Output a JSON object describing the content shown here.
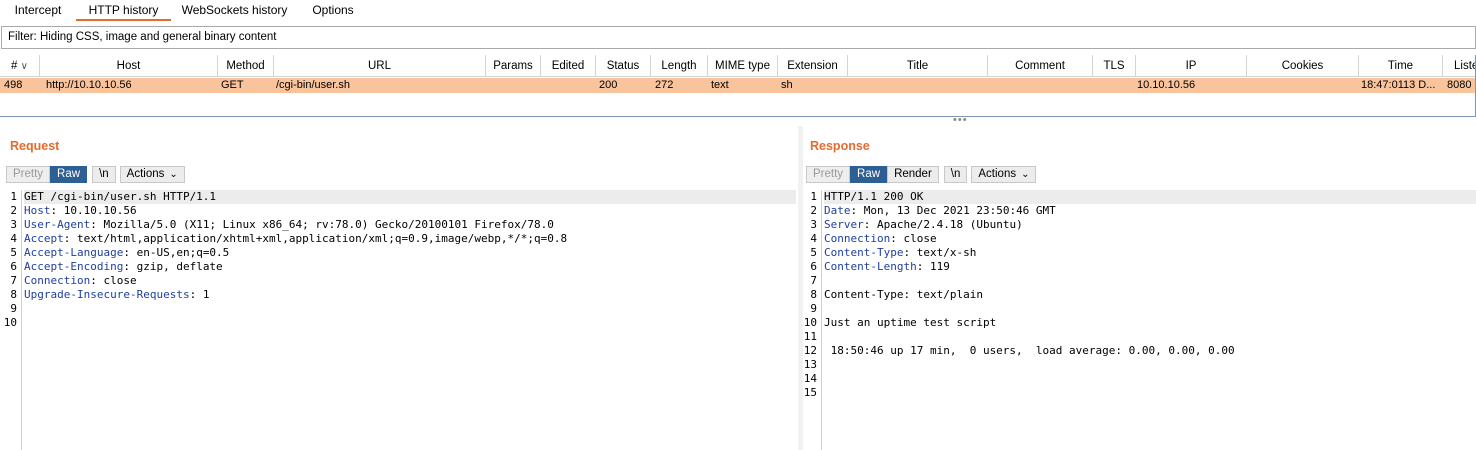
{
  "tabs": [
    {
      "label": "Intercept"
    },
    {
      "label": "HTTP history"
    },
    {
      "label": "WebSockets history"
    },
    {
      "label": "Options"
    }
  ],
  "filter": {
    "text": "Filter: Hiding CSS, image and general binary content"
  },
  "table": {
    "headers": [
      "#",
      "Host",
      "Method",
      "URL",
      "Params",
      "Edited",
      "Status",
      "Length",
      "MIME type",
      "Extension",
      "Title",
      "Comment",
      "TLS",
      "IP",
      "Cookies",
      "Time",
      "Listen"
    ],
    "sort_indicator": "∨",
    "row": {
      "num": "498",
      "host": "http://10.10.10.56",
      "method": "GET",
      "url": "/cgi-bin/user.sh",
      "params": "",
      "edited": "",
      "status": "200",
      "length": "272",
      "mime": "text",
      "extension": "sh",
      "title": "",
      "comment": "",
      "tls": "",
      "ip": "10.10.10.56",
      "cookies": "",
      "time": "18:47:0113 D...",
      "listen": "8080"
    },
    "highlight_color": "#f9c49c"
  },
  "divider": "•••",
  "request": {
    "title": "Request",
    "buttons": {
      "pretty": "Pretty",
      "raw": "Raw",
      "newline": "\\n",
      "actions": "Actions"
    },
    "lines": [
      {
        "n": "1",
        "key": "",
        "rest": "GET /cgi-bin/user.sh HTTP/1.1"
      },
      {
        "n": "2",
        "key": "Host",
        "rest": ": 10.10.10.56"
      },
      {
        "n": "3",
        "key": "User-Agent",
        "rest": ": Mozilla/5.0 (X11; Linux x86_64; rv:78.0) Gecko/20100101 Firefox/78.0"
      },
      {
        "n": "4",
        "key": "Accept",
        "rest": ": text/html,application/xhtml+xml,application/xml;q=0.9,image/webp,*/*;q=0.8"
      },
      {
        "n": "5",
        "key": "Accept-Language",
        "rest": ": en-US,en;q=0.5"
      },
      {
        "n": "6",
        "key": "Accept-Encoding",
        "rest": ": gzip, deflate"
      },
      {
        "n": "7",
        "key": "Connection",
        "rest": ": close"
      },
      {
        "n": "8",
        "key": "Upgrade-Insecure-Requests",
        "rest": ": 1"
      },
      {
        "n": "9",
        "key": "",
        "rest": ""
      },
      {
        "n": "10",
        "key": "",
        "rest": ""
      }
    ]
  },
  "response": {
    "title": "Response",
    "buttons": {
      "pretty": "Pretty",
      "raw": "Raw",
      "render": "Render",
      "newline": "\\n",
      "actions": "Actions"
    },
    "lines": [
      {
        "n": "1",
        "key": "",
        "rest": "HTTP/1.1 200 OK"
      },
      {
        "n": "2",
        "key": "Date",
        "rest": ": Mon, 13 Dec 2021 23:50:46 GMT"
      },
      {
        "n": "3",
        "key": "Server",
        "rest": ": Apache/2.4.18 (Ubuntu)"
      },
      {
        "n": "4",
        "key": "Connection",
        "rest": ": close"
      },
      {
        "n": "5",
        "key": "Content-Type",
        "rest": ": text/x-sh"
      },
      {
        "n": "6",
        "key": "Content-Length",
        "rest": ": 119"
      },
      {
        "n": "7",
        "key": "",
        "rest": ""
      },
      {
        "n": "8",
        "key": "",
        "rest": "Content-Type: text/plain"
      },
      {
        "n": "9",
        "key": "",
        "rest": ""
      },
      {
        "n": "10",
        "key": "",
        "rest": "Just an uptime test script"
      },
      {
        "n": "11",
        "key": "",
        "rest": ""
      },
      {
        "n": "12",
        "key": "",
        "rest": " 18:50:46 up 17 min,  0 users,  load average: 0.00, 0.00, 0.00"
      },
      {
        "n": "13",
        "key": "",
        "rest": ""
      },
      {
        "n": "14",
        "key": "",
        "rest": ""
      },
      {
        "n": "15",
        "key": "",
        "rest": ""
      }
    ]
  }
}
